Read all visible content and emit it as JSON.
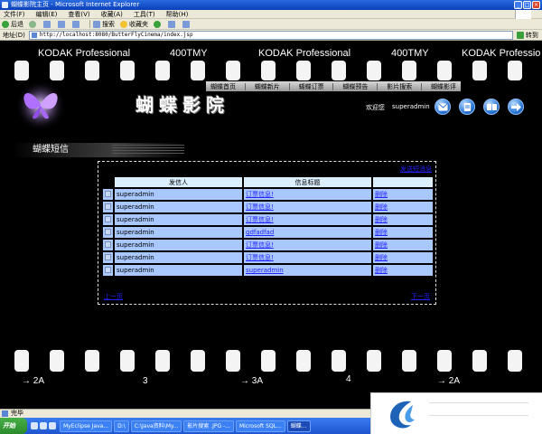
{
  "window": {
    "title": "蝴蝶影院主页 - Microsoft Internet Explorer",
    "controls": [
      "_",
      "□",
      "×"
    ]
  },
  "menubar": {
    "items": [
      "文件(F)",
      "编辑(E)",
      "查看(V)",
      "收藏(A)",
      "工具(T)",
      "帮助(H)"
    ]
  },
  "toolbar": {
    "back": "后退",
    "search": "搜索",
    "favorites": "收藏夹"
  },
  "addressbar": {
    "label": "地址(D)",
    "url": "http://localhost:8080/ButterFlyCinema/index.jsp",
    "go": "转到"
  },
  "film_strip": {
    "top_texts": [
      "KODAK Professional",
      "400TMY",
      "KODAK Professional",
      "400TMY",
      "KODAK Professio"
    ],
    "bottom_numbers": [
      "→ 2A",
      "3",
      "→ 3A",
      "4",
      "→ 2A"
    ]
  },
  "site": {
    "title": "蝴蝶影院",
    "nav": [
      "蝴蝶首页",
      "蝴蝶新片",
      "蝴蝶订票",
      "蝴蝶预告",
      "影片搜索",
      "蝴蝶影评"
    ],
    "welcome_label": "欢迎您",
    "username": "superadmin",
    "icons": [
      "mail-icon",
      "document-icon",
      "book-icon",
      "arrow-icon"
    ]
  },
  "messages": {
    "section_title": "蝴蝶短信",
    "new_link": "发送短消息",
    "columns": [
      "发信人",
      "信息标题",
      ""
    ],
    "rows": [
      {
        "sender": "superadmin",
        "title": "订票信息!",
        "action": "删除"
      },
      {
        "sender": "superadmin",
        "title": "订票信息!",
        "action": "删除"
      },
      {
        "sender": "superadmin",
        "title": "订票信息!",
        "action": "删除"
      },
      {
        "sender": "superadmin",
        "title": "gdfadfad",
        "action": "删除"
      },
      {
        "sender": "superadmin",
        "title": "订票信息!",
        "action": "删除"
      },
      {
        "sender": "superadmin",
        "title": "订票信息!",
        "action": "删除"
      },
      {
        "sender": "superadmin",
        "title": "superadmin",
        "action": "删除"
      }
    ],
    "prev": "上一页",
    "next": "下一页"
  },
  "statusbar": {
    "text": "完毕"
  },
  "taskbar": {
    "start": "开始",
    "tasks": [
      "MyEclipse Java...",
      "D:\\",
      "C:\\Java资料\\My...",
      "影片搜索 .JPG -...",
      "Microsoft SQL...",
      "蝴蝶..."
    ]
  }
}
